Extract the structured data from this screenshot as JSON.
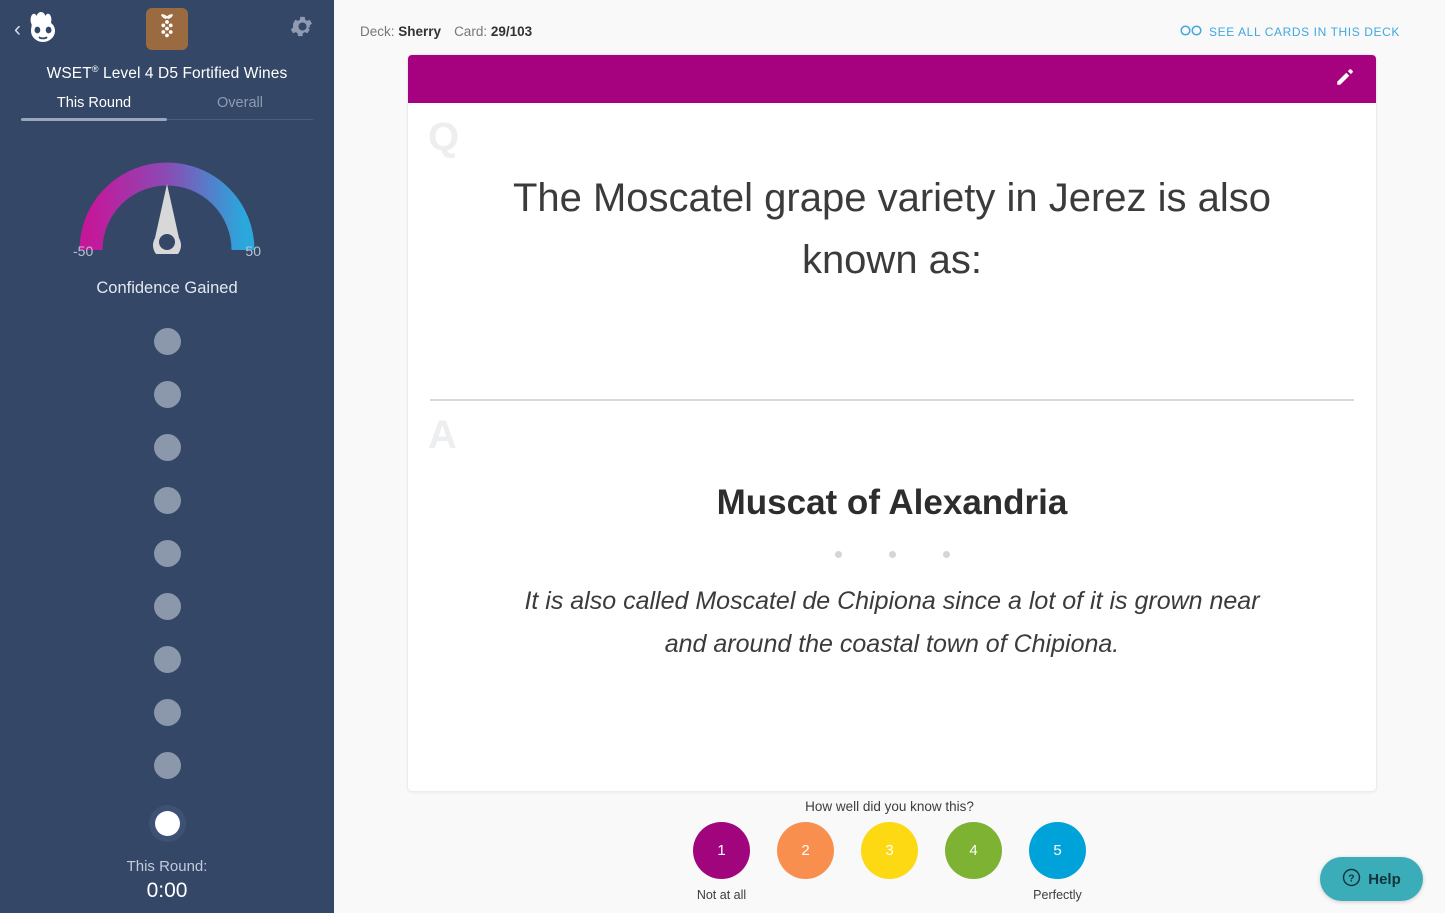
{
  "sidebar": {
    "back_icon": "chevron-left-icon",
    "logo_icon": "brainscape-mascot-icon",
    "deck_badge_icon": "grapes-icon",
    "settings_icon": "gear-icon",
    "deck_title": "WSET",
    "deck_title_sup": "®",
    "deck_title_rest": " Level 4 D5 Fortified Wines",
    "tabs": [
      {
        "label": "This Round",
        "active": true
      },
      {
        "label": "Overall",
        "active": false
      }
    ],
    "gauge": {
      "min_label": "-50",
      "max_label": "50",
      "caption": "Confidence Gained",
      "value": 0,
      "color_left": "#c4189a",
      "color_right": "#2aa7db"
    },
    "progress_dots": {
      "total": 10,
      "current_index": 9,
      "inactive_color": "#8b97ab",
      "active_color": "#ffffff"
    },
    "timer": {
      "label": "This Round:",
      "value": "0:00"
    },
    "background_color": "#344767"
  },
  "header": {
    "deck_label": "Deck:",
    "deck_name": "Sherry",
    "card_label": "Card:",
    "card_position": "29/103",
    "see_all_icon": "glasses-icon",
    "see_all_label": "SEE ALL CARDS IN THIS DECK",
    "link_color": "#41a7e0"
  },
  "card": {
    "accent_color": "#a6017f",
    "edit_icon": "pencil-icon",
    "question_marker": "Q",
    "question_text": "The Moscatel grape variety in Jerez is also known as:",
    "answer_marker": "A",
    "answer_title": "Muscat of Alexandria",
    "answer_note": "It is also called Moscatel de Chipiona since a lot of it is grown near and around the coastal town of Chipiona."
  },
  "rating": {
    "prompt": "How well did you know this?",
    "low_caption": "Not at all",
    "high_caption": "Perfectly",
    "buttons": [
      {
        "value": "1",
        "color": "#a1057e"
      },
      {
        "value": "2",
        "color": "#f98f4e"
      },
      {
        "value": "3",
        "color": "#fcd913"
      },
      {
        "value": "4",
        "color": "#7db233"
      },
      {
        "value": "5",
        "color": "#00a3d9"
      }
    ]
  },
  "help": {
    "icon": "question-circle-icon",
    "label": "Help",
    "color": "#3aadb8"
  }
}
